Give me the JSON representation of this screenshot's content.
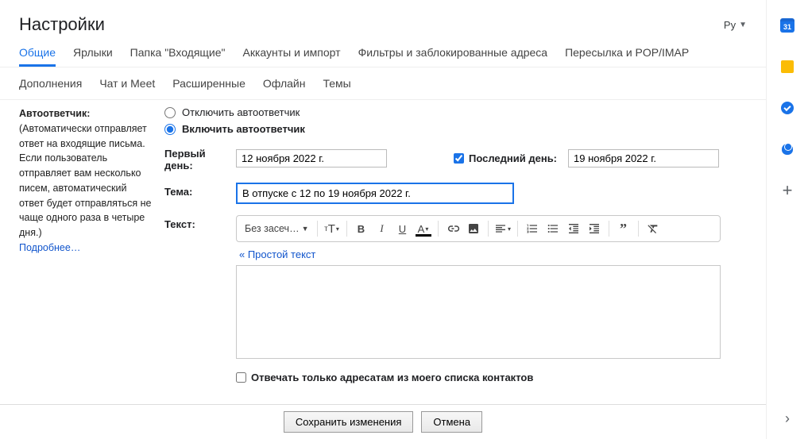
{
  "header": {
    "title": "Настройки",
    "language": "Ру"
  },
  "tabs_row1": [
    {
      "label": "Общие",
      "active": true
    },
    {
      "label": "Ярлыки"
    },
    {
      "label": "Папка \"Входящие\""
    },
    {
      "label": "Аккаунты и импорт"
    },
    {
      "label": "Фильтры и заблокированные адреса"
    },
    {
      "label": "Пересылка и POP/IMAP"
    }
  ],
  "tabs_row2": [
    {
      "label": "Дополнения"
    },
    {
      "label": "Чат и Meet"
    },
    {
      "label": "Расширенные"
    },
    {
      "label": "Офлайн"
    },
    {
      "label": "Темы"
    }
  ],
  "autoresponder": {
    "title": "Автоответчик:",
    "description": "(Автоматически отправляет ответ на входящие письма. Если пользователь отправляет вам несколько писем, автоматический ответ будет отправляться не чаще одного раза в четыре дня.)",
    "more": "Подробнее…",
    "radio_off": "Отключить автоответчик",
    "radio_on": "Включить автоответчик",
    "first_day_label": "Первый день:",
    "first_day_value": "12 ноября 2022 г.",
    "last_day_label": "Последний день:",
    "last_day_value": "19 ноября 2022 г.",
    "subject_label": "Тема:",
    "subject_value": "В отпуске с 12 по 19 ноября 2022 г.",
    "body_label": "Текст:",
    "font_selector": "Без засеч…",
    "plain_text_link": "« Простой текст",
    "contacts_only": "Отвечать только адресатам из моего списка контактов"
  },
  "footer": {
    "save": "Сохранить изменения",
    "cancel": "Отмена"
  },
  "sidepanel": {
    "calendar_day": "31"
  }
}
